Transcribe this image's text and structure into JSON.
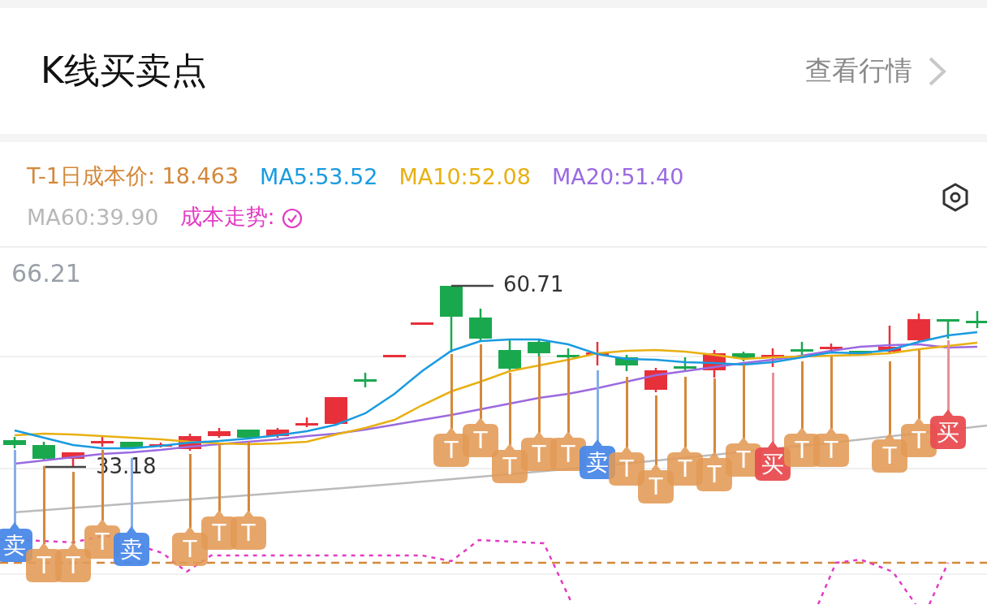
{
  "header": {
    "title": "K线买卖点",
    "link": "查看行情"
  },
  "legend": {
    "rows": [
      [
        {
          "kind": "value",
          "text": "T-1日成本价: 18.463",
          "color": "#d4883a"
        },
        {
          "kind": "value",
          "text": "MA5:53.52",
          "color": "#1a9be0"
        },
        {
          "kind": "value",
          "text": "MA10:52.08",
          "color": "#e8b012"
        },
        {
          "kind": "value",
          "text": "MA20:51.40",
          "color": "#9b6ae0"
        }
      ],
      [
        {
          "kind": "value",
          "text": "MA60:39.90",
          "color": "#b8b8b8"
        },
        {
          "kind": "toggle",
          "text": "成本走势:",
          "color": "#e33bc4",
          "checked": true
        }
      ]
    ]
  },
  "chart": {
    "axis_max": "66.21",
    "high_label": "60.71",
    "low_label": "33.18",
    "markers": [
      {
        "label": "卖",
        "kind": "sell"
      },
      {
        "label": "T",
        "kind": "t"
      },
      {
        "label": "T",
        "kind": "t"
      },
      {
        "label": "T",
        "kind": "t"
      },
      {
        "label": "卖",
        "kind": "sell"
      },
      {
        "label": "T",
        "kind": "t"
      },
      {
        "label": "T",
        "kind": "t"
      },
      {
        "label": "T",
        "kind": "t"
      },
      {
        "label": "T",
        "kind": "t"
      },
      {
        "label": "T",
        "kind": "t"
      },
      {
        "label": "T",
        "kind": "t"
      },
      {
        "label": "T",
        "kind": "t"
      },
      {
        "label": "T",
        "kind": "t"
      },
      {
        "label": "卖",
        "kind": "sell"
      },
      {
        "label": "T",
        "kind": "t"
      },
      {
        "label": "T",
        "kind": "t"
      },
      {
        "label": "T",
        "kind": "t"
      },
      {
        "label": "T",
        "kind": "t"
      },
      {
        "label": "T",
        "kind": "t"
      },
      {
        "label": "买",
        "kind": "buy"
      },
      {
        "label": "T",
        "kind": "t"
      },
      {
        "label": "T",
        "kind": "t"
      },
      {
        "label": "T",
        "kind": "t"
      },
      {
        "label": "T",
        "kind": "t"
      },
      {
        "label": "买",
        "kind": "buy"
      }
    ]
  }
}
